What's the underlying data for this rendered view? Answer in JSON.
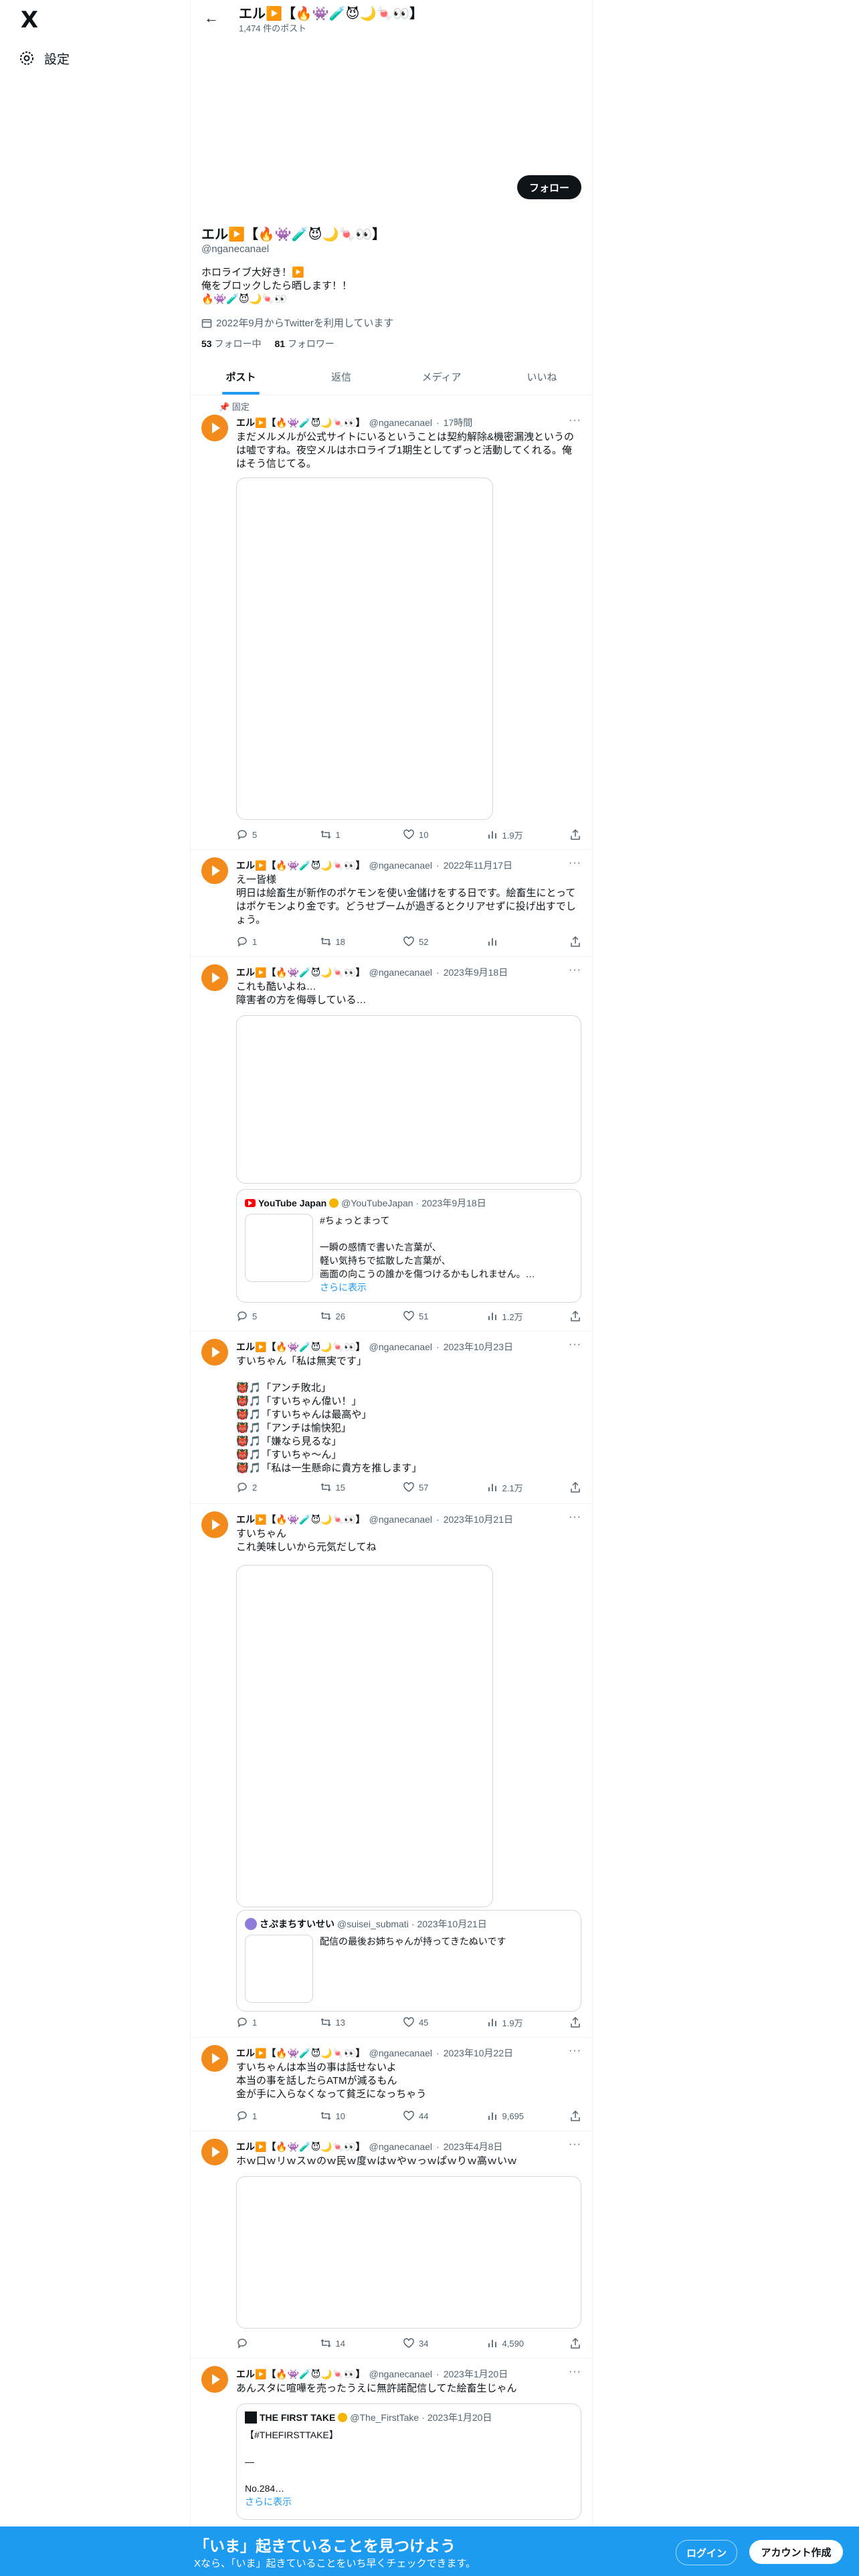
{
  "nav": {
    "logo": "X",
    "settings_label": "設定"
  },
  "header": {
    "name": "エル▶️【🔥👾🧪😈🌙🍬👀】",
    "post_count": "1,474 件のポスト"
  },
  "profile": {
    "follow_label": "フォロー",
    "name": "エル▶️【🔥👾🧪😈🌙🍬👀】",
    "handle": "@nganecanael",
    "bio": "ホロライブ大好き！▶️\n俺をブロックしたら晒します！！\n🔥👾🧪😈🌙🍬👀",
    "joined": "2022年9月からTwitterを利用しています",
    "following_count": "53",
    "following_label": "フォロー中",
    "followers_count": "81",
    "followers_label": "フォロワー"
  },
  "tabs": [
    "ポスト",
    "返信",
    "メディア",
    "いいね"
  ],
  "pinned_label": "固定",
  "tweets": [
    {
      "name": "エル▶️【🔥👾🧪😈🌙🍬👀】",
      "handle": "@nganecanael",
      "time": "17時間",
      "text": "まだメルメルが公式サイトにいるということは契約解除&機密漏洩というのは嘘ですね。夜空メルはホロライブ1期生としてずっと活動してくれる。俺はそう信じてる。",
      "reply": "5",
      "retweet": "1",
      "like": "10",
      "views": "1.9万"
    },
    {
      "name": "エル▶️【🔥👾🧪😈🌙🍬👀】",
      "handle": "@nganecanael",
      "time": "2022年11月17日",
      "text": "え一皆様\n明日は絵畜生が新作のポケモンを使い金儲けをする日です。絵畜生にとってはポケモンより金です。どうせブームが過ぎるとクリアせずに投げ出すでしょう。",
      "reply": "1",
      "retweet": "18",
      "like": "52",
      "views": ""
    },
    {
      "name": "エル▶️【🔥👾🧪😈🌙🍬👀】",
      "handle": "@nganecanael",
      "time": "2023年9月18日",
      "text": "これも酷いよね…\n障害者の方を侮辱している…",
      "quote": {
        "name": "YouTube Japan",
        "handle": "@YouTubeJapan",
        "time": "2023年9月18日",
        "text": "#ちょっとまって\n\n一瞬の感情で書いた言葉が、\n軽い気持ちで拡散した言葉が、\n画面の向こうの誰かを傷つけるかもしれません。…",
        "more": "さらに表示"
      },
      "reply": "5",
      "retweet": "26",
      "like": "51",
      "views": "1.2万"
    },
    {
      "name": "エル▶️【🔥👾🧪😈🌙🍬👀】",
      "handle": "@nganecanael",
      "time": "2023年10月23日",
      "text": "すいちゃん「私は無実です」\n\n👹🎵「アンチ敗北」\n👹🎵「すいちゃん偉い！」\n👹🎵「すいちゃんは最高や」\n👹🎵「アンチは愉快犯」\n👹🎵「嫌なら見るな」\n👹🎵「すいちゃ〜ん」\n👹🎵「私は一生懸命に貴方を推します」",
      "reply": "2",
      "retweet": "15",
      "like": "57",
      "views": "2.1万"
    },
    {
      "name": "エル▶️【🔥👾🧪😈🌙🍬👀】",
      "handle": "@nganecanael",
      "time": "2023年10月21日",
      "text": "すいちゃん\nこれ美味しいから元気だしてね",
      "quote": {
        "name": "さぷまちすいせい",
        "handle": "@suisei_submati",
        "time": "2023年10月21日",
        "text": "配信の最後お姉ちゃんが持ってきたぬいです",
        "more": ""
      },
      "reply": "1",
      "retweet": "13",
      "like": "45",
      "views": "1.9万"
    },
    {
      "name": "エル▶️【🔥👾🧪😈🌙🍬👀】",
      "handle": "@nganecanael",
      "time": "2023年10月22日",
      "text": "すいちゃんは本当の事は話せないよ\n本当の事を話したらATMが減るもん\n金が手に入らなくなって貧乏になっちゃう",
      "reply": "1",
      "retweet": "10",
      "like": "44",
      "views": "9,695"
    },
    {
      "name": "エル▶️【🔥👾🧪😈🌙🍬👀】",
      "handle": "@nganecanael",
      "time": "2023年4月8日",
      "text": "ホｗ口ｗリｗスｗのｗ民ｗ度ｗはｗやｗっｗぱｗりｗ高ｗいｗ",
      "reply": "",
      "retweet": "14",
      "like": "34",
      "views": "4,590"
    },
    {
      "name": "エル▶️【🔥👾🧪😈🌙🍬👀】",
      "handle": "@nganecanael",
      "time": "2023年1月20日",
      "text": "あんスタに喧嘩を売ったうえに無許諾配信してた絵畜生じゃん",
      "quote": {
        "name": "THE FIRST TAKE",
        "handle": "@The_FirstTake",
        "time": "2023年1月20日",
        "text": "【#THEFIRSTTAKE】\n\n―\n\nNo.284…",
        "more": "さらに表示"
      },
      "reply": "",
      "retweet": "",
      "like": "",
      "views": ""
    }
  ],
  "bottom": {
    "title": "「いま」起きていることを見つけよう",
    "subtitle": "Xなら、「いま」起きていることをいち早くチェックできます。",
    "login": "ログイン",
    "signup": "アカウント作成"
  }
}
